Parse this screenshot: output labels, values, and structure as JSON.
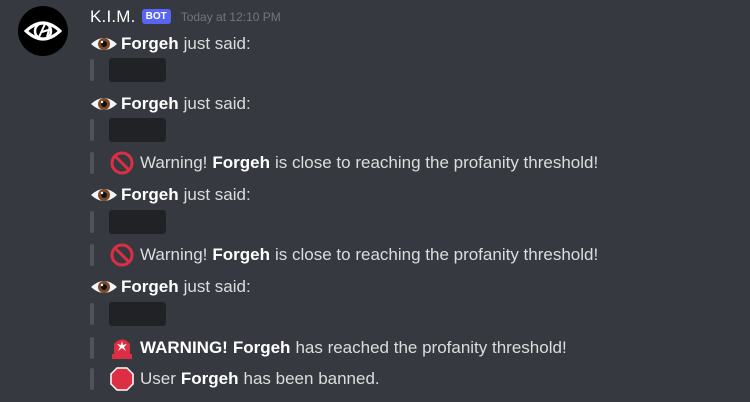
{
  "bot": {
    "name": "K.I.M.",
    "tag": "BOT",
    "timestamp": "Today at 12:10 PM"
  },
  "user": "Forgeh",
  "text": {
    "just_said": "just said:",
    "warning_prefix": "Warning!",
    "close_to_threshold": "is close to reaching the profanity threshold!",
    "warning_caps": "WARNING!",
    "reached_threshold": "has reached the profanity threshold!",
    "user_word": "User",
    "banned": "has been banned."
  },
  "icons": {
    "avatar": "eye-logo-avatar",
    "said": "eye-icon",
    "warning": "no-entry-sign-icon",
    "alert": "rotating-light-icon",
    "ban": "stop-sign-icon"
  },
  "colors": {
    "background": "#36393f",
    "bot_tag": "#5865f2",
    "spoiler": "#202225",
    "quote_bar": "#4f545c",
    "warning_red": "#dd2e44"
  }
}
